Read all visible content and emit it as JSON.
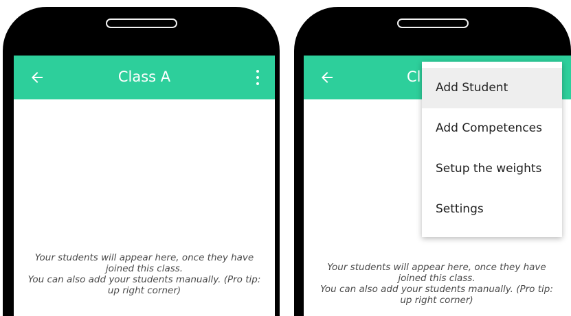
{
  "left_screen": {
    "title": "Class A",
    "message_line1": "Your students will appear here, once they have",
    "message_line2": "joined this class.",
    "message_line3": "You can also add your students manually. (Pro tip:",
    "message_line4": "up right corner)"
  },
  "right_screen": {
    "title_partial": "Cl",
    "menu_items": [
      {
        "label": "Add Student",
        "highlighted": true
      },
      {
        "label": "Add Competences",
        "highlighted": false
      },
      {
        "label": "Setup the weights",
        "highlighted": false
      },
      {
        "label": "Settings",
        "highlighted": false
      }
    ],
    "message_line1": "Your students will appear here, once they have",
    "message_line2": "joined this class.",
    "message_line3": "You can also add your students manually. (Pro tip:",
    "message_line4": "up right corner)"
  },
  "icons": {
    "back": "back-arrow-icon",
    "more": "more-vertical-icon"
  },
  "colors": {
    "appbar": "#2dcf9b",
    "phone_frame": "#000000",
    "menu_highlight": "#eeeeee"
  }
}
